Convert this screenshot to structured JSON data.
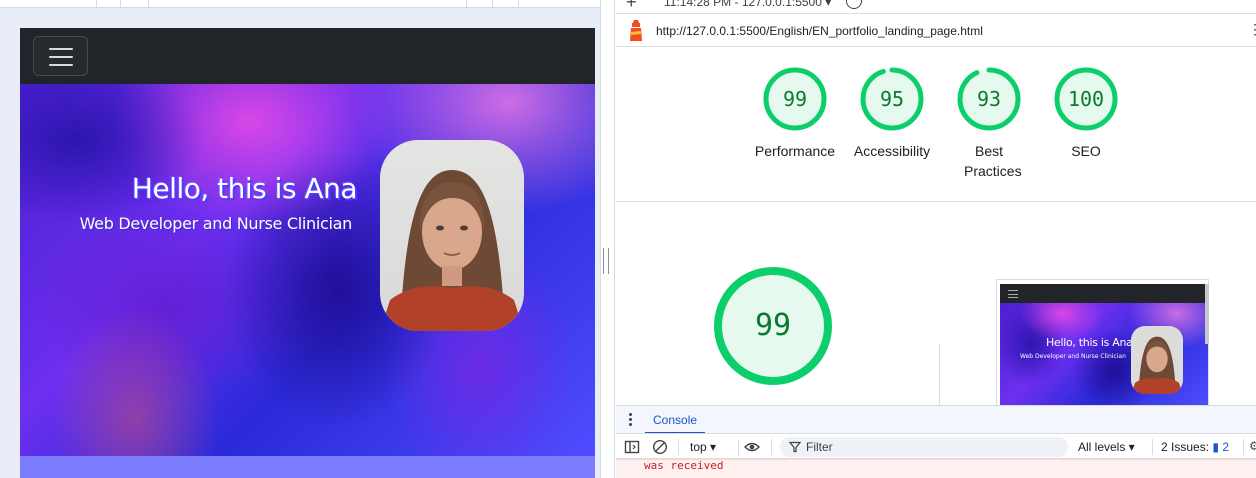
{
  "site": {
    "hero_title": "Hello, this is Ana",
    "hero_subtitle": "Web Developer and Nurse Clinician"
  },
  "devtools": {
    "timestamp": "11:14:28 PM - 127.0.0.1:5500 ▾",
    "url": "http://127.0.0.1:5500/English/EN_portfolio_landing_page.html",
    "scores": [
      {
        "value": "99",
        "label": "Performance"
      },
      {
        "value": "95",
        "label": "Accessibility"
      },
      {
        "value": "93",
        "label": "Best Practices"
      },
      {
        "value": "100",
        "label": "SEO"
      }
    ],
    "main_score": "99",
    "thumbnail": {
      "title": "Hello, this is Ana",
      "subtitle": "Web Developer and Nurse Clinician"
    },
    "score_color": "#0cce6b",
    "score_fill": "#e6f9ee"
  },
  "console": {
    "tab_label": "Console",
    "context": "top ▾",
    "filter_placeholder": "Filter",
    "levels": "All levels ▾",
    "issues_label": "2 Issues:",
    "issues_count": "2",
    "message": "was received"
  }
}
